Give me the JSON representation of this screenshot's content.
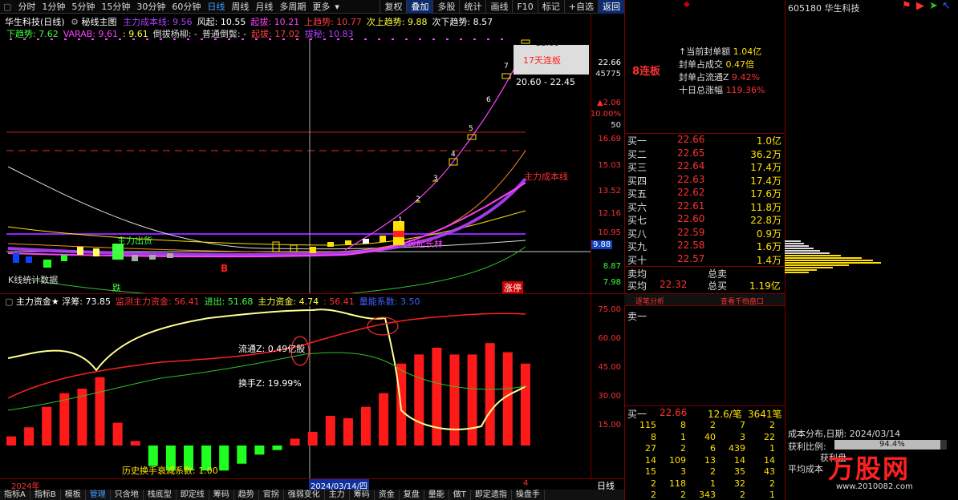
{
  "toolbar": {
    "tabs": [
      "分时",
      "1分钟",
      "5分钟",
      "15分钟",
      "30分钟",
      "60分钟",
      "日线",
      "周线",
      "月线",
      "多周期",
      "更多"
    ],
    "active_tab": "日线",
    "right_buttons": [
      "复权",
      "叠加",
      "多股",
      "统计",
      "画线",
      "F10",
      "标记",
      "+自选",
      "返回"
    ]
  },
  "main_chart": {
    "title": "华生科技(日线)",
    "formula": "秘线主图",
    "legend1": [
      {
        "text": "主力成本线: 9.56",
        "color": "#b040ff"
      },
      {
        "text": "风起: 10.55",
        "color": "#ffffff"
      },
      {
        "text": "起拔: 10.21",
        "color": "#ff40ff"
      },
      {
        "text": "上趋势: 10.77",
        "color": "#ff4040"
      },
      {
        "text": "次上趋势: 9.88",
        "color": "#ffff40"
      },
      {
        "text": "次下趋势: 8.57",
        "color": "#ffffff"
      }
    ],
    "legend2": [
      {
        "text": "下趋势: 7.62",
        "color": "#40ff40"
      },
      {
        "text": "VARAB: 9.61",
        "color": "#ff40ff"
      },
      {
        "text": ": 9.61",
        "color": "#ffff40"
      },
      {
        "text": "倒拔杨柳: -",
        "color": "#dddddd"
      },
      {
        "text": "普通倒鬓: -",
        "color": "#dddddd"
      },
      {
        "text": "起拔: 17.02",
        "color": "#ff4040"
      },
      {
        "text": "拔秘: 10.83",
        "color": "#b040ff"
      }
    ],
    "annotations": {
      "lianban_label": "17天连板",
      "price_high": "22.66",
      "range_label": "20.60 - 22.45",
      "cost_line_label": "主力成本线",
      "main_out_label": "主力出货",
      "rise_label": "风起长林",
      "fall_label": "跌",
      "limit_label": "涨停",
      "buy_marker": "B",
      "chip_label": "K线统计数据"
    },
    "counts": [
      "1",
      "2",
      "3",
      "4",
      "5",
      "6",
      "7"
    ],
    "yaxis": [
      "22.66",
      "45775",
      "▲2.06",
      "10.00%",
      "50",
      "16.69",
      "15.03",
      "13.52",
      "12.16",
      "10.95",
      "9.88",
      "8.87",
      "7.98"
    ],
    "current_price_tag": "9.88"
  },
  "sub_chart": {
    "title": "主力资金★",
    "legend": [
      {
        "text": "浮筹: 73.85",
        "color": "#ffffff"
      },
      {
        "text": "监测主力资金: 56.41",
        "color": "#ff3030"
      },
      {
        "text": "进出: 51.68",
        "color": "#40ff40"
      },
      {
        "text": "主力资金: 4.74",
        "color": "#ffff40"
      },
      {
        "text": ": 56.41",
        "color": "#ff3030"
      },
      {
        "text": "量能系数: 3.50",
        "color": "#4060ff"
      }
    ],
    "flow_label": "流通Z: 0.49亿股",
    "turnover_label": "换手Z: 19.99%",
    "history_label": "历史换手衰减系数: 1.00",
    "yaxis": [
      "75.00",
      "60.00",
      "45.00",
      "30.00",
      "15.00"
    ]
  },
  "bottom": {
    "year": "2024年",
    "date": "2024/03/14/四",
    "period": "日线",
    "page": "4",
    "tabs": [
      "指标A",
      "指标B",
      "模板",
      "管理",
      "只含地",
      "栈底型",
      "即定线",
      "筹码",
      "趋势",
      "官拐",
      "强弱变化",
      "主力",
      "筹码",
      "资金",
      "复盘",
      "量能",
      "做T",
      "即定遗指",
      "操盘手"
    ]
  },
  "quote": {
    "stock_header": "605180 华生科技",
    "lianban": "8连板",
    "info": [
      {
        "label": "当前封单额",
        "value": "1.04亿"
      },
      {
        "label": "封单占成交",
        "value": "0.47倍"
      },
      {
        "label": "封单占流通Z",
        "value": "9.42%"
      },
      {
        "label": "十日总涨幅",
        "value": "119.36%"
      }
    ],
    "bids": [
      {
        "level": "买一",
        "price": "22.66",
        "vol": "1.0亿"
      },
      {
        "level": "买二",
        "price": "22.65",
        "vol": "36.2万"
      },
      {
        "level": "买三",
        "price": "22.64",
        "vol": "17.4万"
      },
      {
        "level": "买四",
        "price": "22.63",
        "vol": "17.4万"
      },
      {
        "level": "买五",
        "price": "22.62",
        "vol": "17.6万"
      },
      {
        "level": "买六",
        "price": "22.61",
        "vol": "11.8万"
      },
      {
        "level": "买七",
        "price": "22.60",
        "vol": "22.8万"
      },
      {
        "level": "买八",
        "price": "22.59",
        "vol": "0.9万"
      },
      {
        "level": "买九",
        "price": "22.58",
        "vol": "1.6万"
      },
      {
        "level": "买十",
        "price": "22.57",
        "vol": "1.4万"
      }
    ],
    "sell_avg_label": "卖均",
    "total_sell_label": "总卖",
    "buy_avg_label": "买均",
    "buy_avg": "22.32",
    "total_buy_label": "总买",
    "total_buy": "1.19亿",
    "tab1": "逐笔分析",
    "tab2": "查看千档盘口",
    "sell1_label": "卖一",
    "queue_head": {
      "level": "买一",
      "price": "22.66",
      "per": "12.6/笔",
      "count": "3641笔"
    },
    "queue": [
      [
        "115",
        "8",
        "2",
        "7",
        "2"
      ],
      [
        "8",
        "1",
        "40",
        "3",
        "22"
      ],
      [
        "27",
        "2",
        "6",
        "439",
        "1"
      ],
      [
        "14",
        "109",
        "13",
        "14",
        "14"
      ],
      [
        "15",
        "3",
        "2",
        "35",
        "43"
      ],
      [
        "2",
        "118",
        "1",
        "32",
        "2"
      ],
      [
        "2",
        "2",
        "343",
        "2",
        "1"
      ]
    ]
  },
  "chip": {
    "date_label": "成本分布,日期: 2024/03/14",
    "profit_label": "获利比例:",
    "profit_value": "94.4%",
    "line2": "获利盘",
    "line3": "平均成本"
  },
  "watermark": "万股网",
  "watermark_url": "www.2010082.com"
}
